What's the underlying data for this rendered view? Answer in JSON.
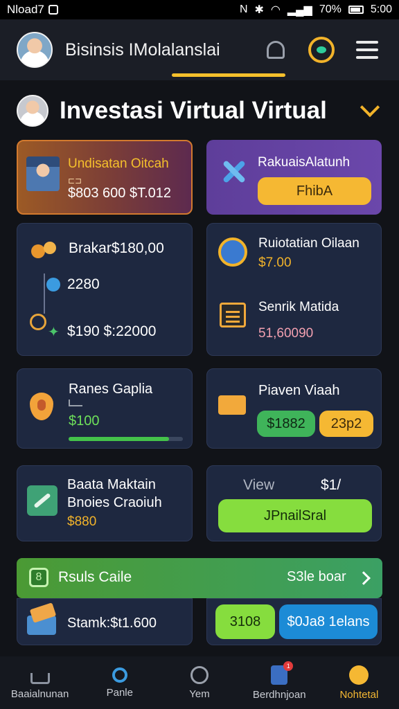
{
  "status_bar": {
    "carrier": "Nload7",
    "battery_text": "70%",
    "time": "5:00"
  },
  "header": {
    "title": "Bisinsis IMolalanslai"
  },
  "section": {
    "title": "Investasi Virtual  Virtual"
  },
  "cards": {
    "c1": {
      "title": "Undisatan Oitcah",
      "values": "$803  600  $T.012"
    },
    "c2": {
      "title": "RakuaisAlatunh",
      "button": "FhibA"
    },
    "c3": {
      "line1": "Brakar$180,00",
      "line2": "2280",
      "line3": "$190 $:22000"
    },
    "c4": {
      "title1": "Ruiotatian Oilaan",
      "value1": "$7.00",
      "title2": "Senrik Matida",
      "value2": "51,60090"
    },
    "c5": {
      "title": "Ranes Gaplia",
      "value": "$100",
      "progress": 0.88
    },
    "c6": {
      "title": "Piaven Viaah",
      "pill1": "$1882",
      "pill2": "23p2"
    },
    "c7": {
      "line1": "Baata Maktain",
      "line2": "Bnoies Craoiuh",
      "value": "$880"
    },
    "c8": {
      "view": "View",
      "amount": "$1/",
      "button": "JPnailSral"
    },
    "banner": {
      "title": "Rsuls Caile",
      "link": "S3le boar"
    },
    "c9": {
      "text": "Stamk:$t1.600"
    },
    "c10": {
      "pill1": "3108",
      "pill2": "$0Ja8 1elans"
    }
  },
  "nav": [
    {
      "label": "Baaialnunan"
    },
    {
      "label": "Panle"
    },
    {
      "label": "Yem"
    },
    {
      "label": "Berdhnjoan"
    },
    {
      "label": "Nohtetal"
    }
  ],
  "colors": {
    "accent": "#f5b833",
    "background": "#111318",
    "card": "#1e2840",
    "green": "#44c24a"
  }
}
